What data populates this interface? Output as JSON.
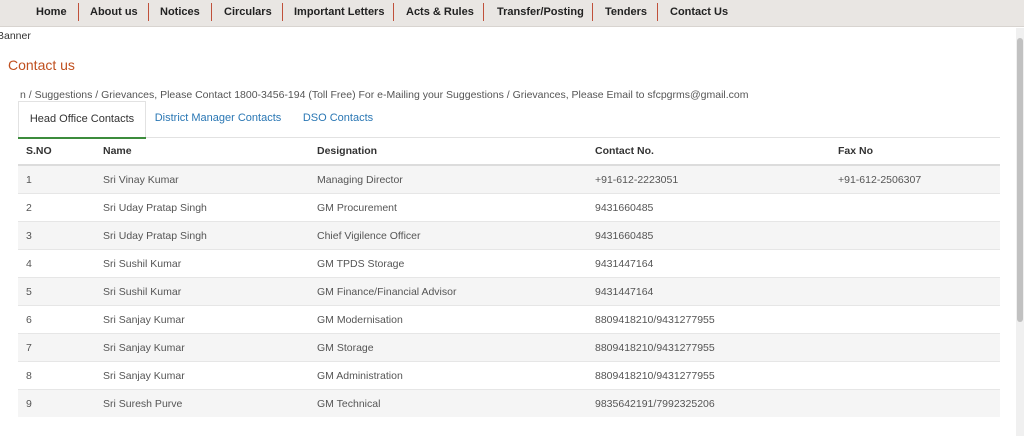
{
  "nav": [
    "Home",
    "About us",
    "Notices",
    "Circulars",
    "Important Letters",
    "Acts & Rules",
    "Transfer/Posting",
    "Tenders",
    "Contact Us"
  ],
  "banner_alt": "Banner",
  "page_title": "Contact us",
  "notice": "n / Suggestions / Grievances, Please Contact 1800-3456-194 (Toll Free) For e-Mailing your Suggestions / Grievances, Please Email to sfcpgrms@gmail.com",
  "tabs": [
    "Head Office Contacts",
    "District Manager Contacts",
    "DSO Contacts"
  ],
  "table": {
    "headers": [
      "S.NO",
      "Name",
      "Designation",
      "Contact No.",
      "Fax No"
    ],
    "rows": [
      [
        "1",
        "Sri Vinay Kumar",
        "Managing Director",
        "+91-612-2223051",
        "+91-612-2506307"
      ],
      [
        "2",
        "Sri Uday Pratap Singh",
        "GM Procurement",
        "9431660485",
        ""
      ],
      [
        "3",
        "Sri Uday Pratap Singh",
        "Chief Vigilence Officer",
        "9431660485",
        ""
      ],
      [
        "4",
        "Sri Sushil Kumar",
        "GM TPDS Storage",
        "9431447164",
        ""
      ],
      [
        "5",
        "Sri Sushil Kumar",
        "GM Finance/Financial Advisor",
        "9431447164",
        ""
      ],
      [
        "6",
        "Sri Sanjay Kumar",
        "GM Modernisation",
        "8809418210/9431277955",
        ""
      ],
      [
        "7",
        "Sri Sanjay Kumar",
        "GM Storage",
        "8809418210/9431277955",
        ""
      ],
      [
        "8",
        "Sri Sanjay Kumar",
        "GM Administration",
        "8809418210/9431277955",
        ""
      ],
      [
        "9",
        "Sri Suresh Purve",
        "GM Technical",
        "9835642191/7992325206",
        ""
      ]
    ]
  }
}
